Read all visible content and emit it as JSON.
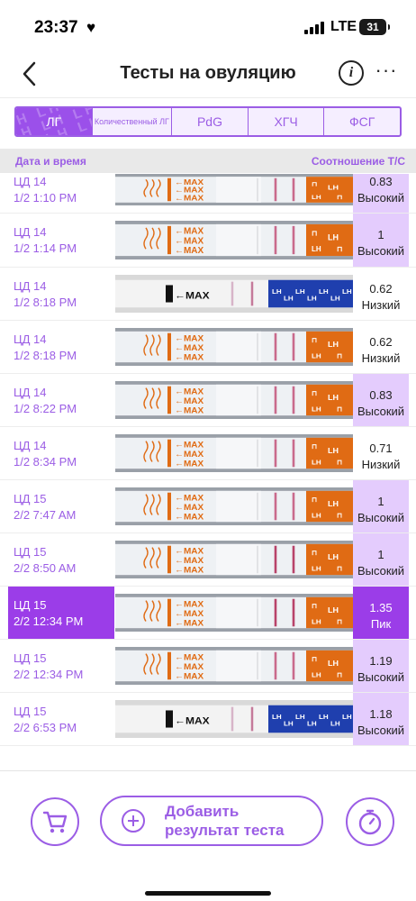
{
  "status_bar": {
    "time": "23:37",
    "network": "LTE",
    "battery": "31"
  },
  "header": {
    "title": "Тесты на овуляцию"
  },
  "tabs": [
    {
      "label": "ЛГ",
      "active": true
    },
    {
      "label": "Количественный ЛГ",
      "active": false
    },
    {
      "label": "PdG",
      "active": false
    },
    {
      "label": "ХГЧ",
      "active": false
    },
    {
      "label": "ФСГ",
      "active": false
    }
  ],
  "table": {
    "col_date": "Дата и время",
    "col_ratio": "Соотношение Т/С",
    "rows": [
      {
        "cycle_day": "ЦД 14",
        "datetime": "1/2 1:10 PM",
        "ratio": "0.83",
        "level": "Высокий",
        "strip_brand": "orange"
      },
      {
        "cycle_day": "ЦД 14",
        "datetime": "1/2 1:14 PM",
        "ratio": "1",
        "level": "Высокий",
        "strip_brand": "orange"
      },
      {
        "cycle_day": "ЦД 14",
        "datetime": "1/2 8:18 PM",
        "ratio": "0.62",
        "level": "Низкий",
        "strip_brand": "blue"
      },
      {
        "cycle_day": "ЦД 14",
        "datetime": "1/2 8:18 PM",
        "ratio": "0.62",
        "level": "Низкий",
        "strip_brand": "orange"
      },
      {
        "cycle_day": "ЦД 14",
        "datetime": "1/2 8:22 PM",
        "ratio": "0.83",
        "level": "Высокий",
        "strip_brand": "orange"
      },
      {
        "cycle_day": "ЦД 14",
        "datetime": "1/2 8:34 PM",
        "ratio": "0.71",
        "level": "Низкий",
        "strip_brand": "orange"
      },
      {
        "cycle_day": "ЦД 15",
        "datetime": "2/2 7:47 AM",
        "ratio": "1",
        "level": "Высокий",
        "strip_brand": "orange"
      },
      {
        "cycle_day": "ЦД 15",
        "datetime": "2/2 8:50 AM",
        "ratio": "1",
        "level": "Высокий",
        "strip_brand": "orange"
      },
      {
        "cycle_day": "ЦД 15",
        "datetime": "2/2 12:34 PM",
        "ratio": "1.35",
        "level": "Пик",
        "strip_brand": "orange"
      },
      {
        "cycle_day": "ЦД 15",
        "datetime": "2/2 12:34 PM",
        "ratio": "1.19",
        "level": "Высокий",
        "strip_brand": "orange"
      },
      {
        "cycle_day": "ЦД 15",
        "datetime": "2/2 6:53 PM",
        "ratio": "1.18",
        "level": "Высокий",
        "strip_brand": "blue"
      }
    ]
  },
  "strip_text": {
    "max": "MAX",
    "lh": "LH"
  },
  "bottom": {
    "add_label": "Добавить результат теста"
  },
  "colors": {
    "accent": "#9b5de5",
    "peak": "#9b3de8",
    "highlight": "#e4ccfd",
    "strip_orange": "#e06b14",
    "strip_blue": "#1f3fae"
  }
}
